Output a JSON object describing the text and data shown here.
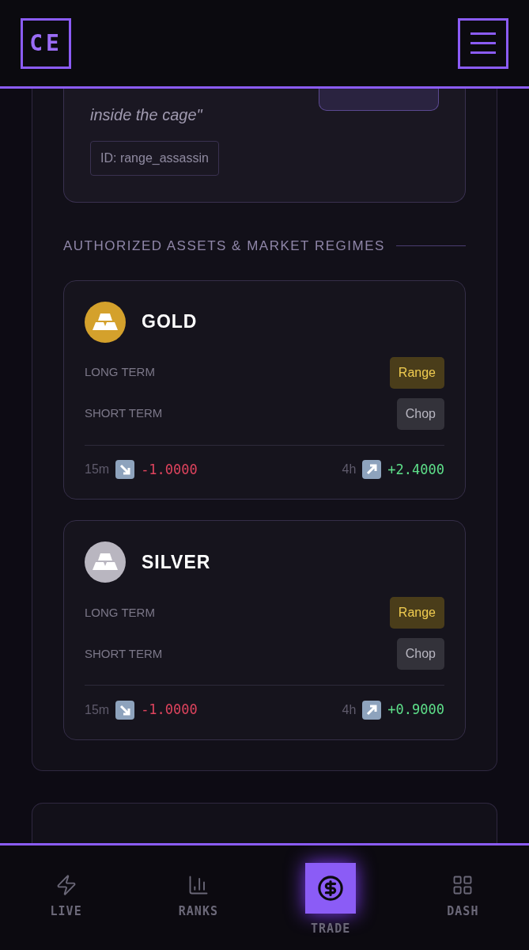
{
  "header": {
    "logo": "CE"
  },
  "strategy": {
    "quote_tail": "inside the cage\"",
    "id": "ID: range_assassin"
  },
  "section_title": "AUTHORIZED ASSETS & MARKET REGIMES",
  "assets": [
    {
      "name": "GOLD",
      "color": "#d4a12c",
      "regimes": [
        {
          "label": "LONG TERM",
          "value": "Range",
          "kind": "range"
        },
        {
          "label": "SHORT TERM",
          "value": "Chop",
          "kind": "chop"
        }
      ],
      "signals": [
        {
          "frame": "15m",
          "kind": "down",
          "value": "-1.0000"
        },
        {
          "frame": "4h",
          "kind": "up",
          "value": "+2.4000"
        }
      ]
    },
    {
      "name": "SILVER",
      "color": "#b9b6c0",
      "regimes": [
        {
          "label": "LONG TERM",
          "value": "Range",
          "kind": "range"
        },
        {
          "label": "SHORT TERM",
          "value": "Chop",
          "kind": "chop"
        }
      ],
      "signals": [
        {
          "frame": "15m",
          "kind": "down",
          "value": "-1.0000"
        },
        {
          "frame": "4h",
          "kind": "up",
          "value": "+0.9000"
        }
      ]
    }
  ],
  "nav": [
    {
      "label": "LIVE",
      "kind": "live",
      "selected": false
    },
    {
      "label": "RANKS",
      "kind": "ranks",
      "selected": false
    },
    {
      "label": "TRADE",
      "kind": "trade",
      "selected": true
    },
    {
      "label": "DASH",
      "kind": "dash",
      "selected": false
    }
  ]
}
